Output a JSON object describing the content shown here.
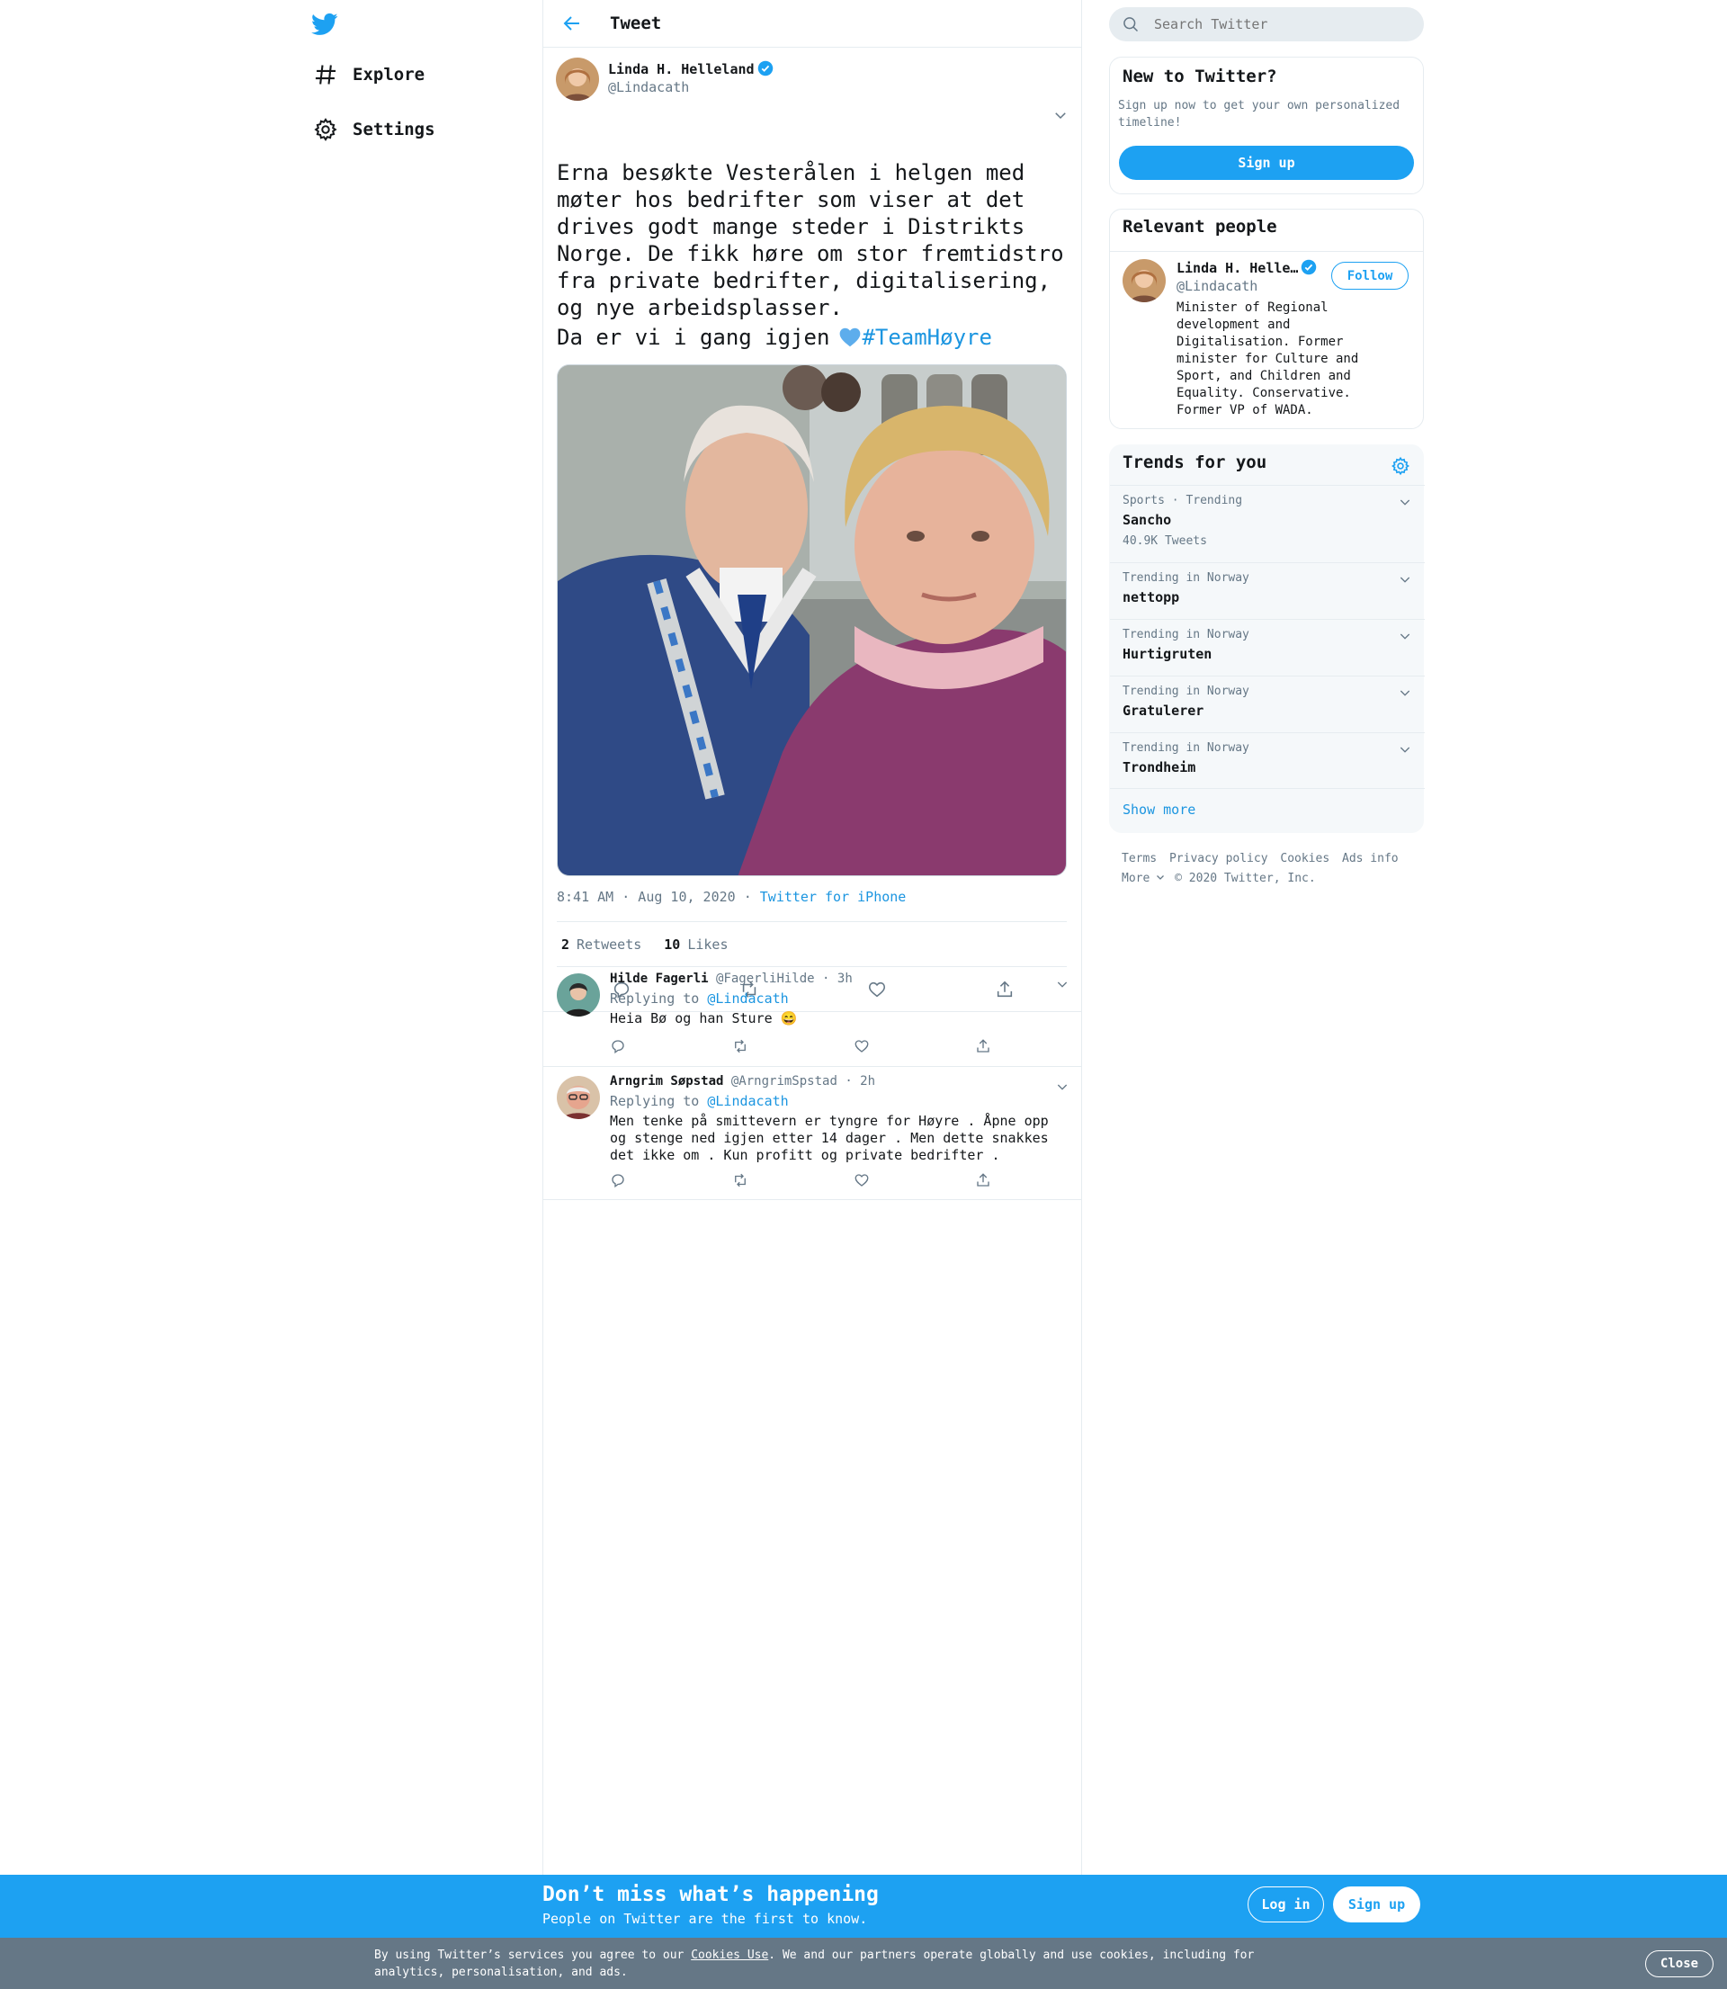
{
  "colors": {
    "accent": "#1da1f2",
    "link": "#1b95e0",
    "muted": "#657786",
    "text": "#14171a",
    "border": "#e6ecf0",
    "cookie_bar": "#657786"
  },
  "nav": {
    "logo_icon": "twitter-bird-icon",
    "items": [
      {
        "label": "Explore",
        "icon": "hashtag-icon"
      },
      {
        "label": "Settings",
        "icon": "gear-icon"
      }
    ]
  },
  "header": {
    "title": "Tweet",
    "back_icon": "arrow-left-icon"
  },
  "tweet": {
    "author_name": "Linda H. Helleland",
    "handle": "@Lindacath",
    "text": "Erna besøkte Vesterålen i helgen med møter hos bedrifter som viser at det drives godt mange steder i Distrikts Norge. De fikk høre om stor fremtidstro fra private bedrifter, digitalisering, og nye arbeidsplasser.",
    "text_line2": "Da er vi i gang igjen",
    "hashtag": "#TeamHøyre",
    "timestamp": "8:41 AM · Aug 10, 2020 · ",
    "source": "Twitter for iPhone",
    "retweets_count": "2",
    "retweets_label": "Retweets",
    "likes_count": "10",
    "likes_label": "Likes"
  },
  "replies": [
    {
      "name": "Hilde Fagerli",
      "handle": "@FagerliHilde",
      "time": "· 3h",
      "replying_prefix": "Replying to",
      "replying_to": "@Lindacath",
      "text": "Heia Bø og han Sture 😄"
    },
    {
      "name": "Arngrim Søpstad",
      "handle": "@ArngrimSpstad",
      "time": "· 2h",
      "replying_prefix": "Replying to",
      "replying_to": "@Lindacath",
      "text": "Men tenke på smittevern er tyngre for Høyre . Åpne opp og stenge ned igjen etter 14 dager . Men dette snakkes det ikke om . Kun profitt og private bedrifter ."
    }
  ],
  "search": {
    "placeholder": "Search Twitter"
  },
  "new_to_twitter": {
    "title": "New to Twitter?",
    "text": "Sign up now to get your own personalized timeline!",
    "button": "Sign up"
  },
  "relevant_people": {
    "title": "Relevant people",
    "name": "Linda H. Helle…",
    "handle": "@Lindacath",
    "follow": "Follow",
    "bio": "Minister of Regional development and Digitalisation. Former minister for Culture and Sport, and Children and Equality. Conservative. Former VP of WADA."
  },
  "trends": {
    "title": "Trends for you",
    "items": [
      {
        "context": "Sports · Trending",
        "name": "Sancho",
        "count": "40.9K Tweets"
      },
      {
        "context": "Trending in Norway",
        "name": "nettopp",
        "count": ""
      },
      {
        "context": "Trending in Norway",
        "name": "Hurtigruten",
        "count": ""
      },
      {
        "context": "Trending in Norway",
        "name": "Gratulerer",
        "count": ""
      },
      {
        "context": "Trending in Norway",
        "name": "Trondheim",
        "count": ""
      }
    ],
    "show_more": "Show more"
  },
  "footer": {
    "links": [
      "Terms",
      "Privacy policy",
      "Cookies",
      "Ads info"
    ],
    "more": "More",
    "copyright": "© 2020 Twitter, Inc."
  },
  "cta": {
    "title": "Don’t miss what’s happening",
    "subtitle": "People on Twitter are the first to know.",
    "login": "Log in",
    "signup": "Sign up"
  },
  "cookie": {
    "text_before": "By using Twitter’s services you agree to our ",
    "link": "Cookies Use",
    "text_after": ". We and our partners operate globally and use cookies, including for analytics, personalisation, and ads.",
    "close": "Close"
  }
}
